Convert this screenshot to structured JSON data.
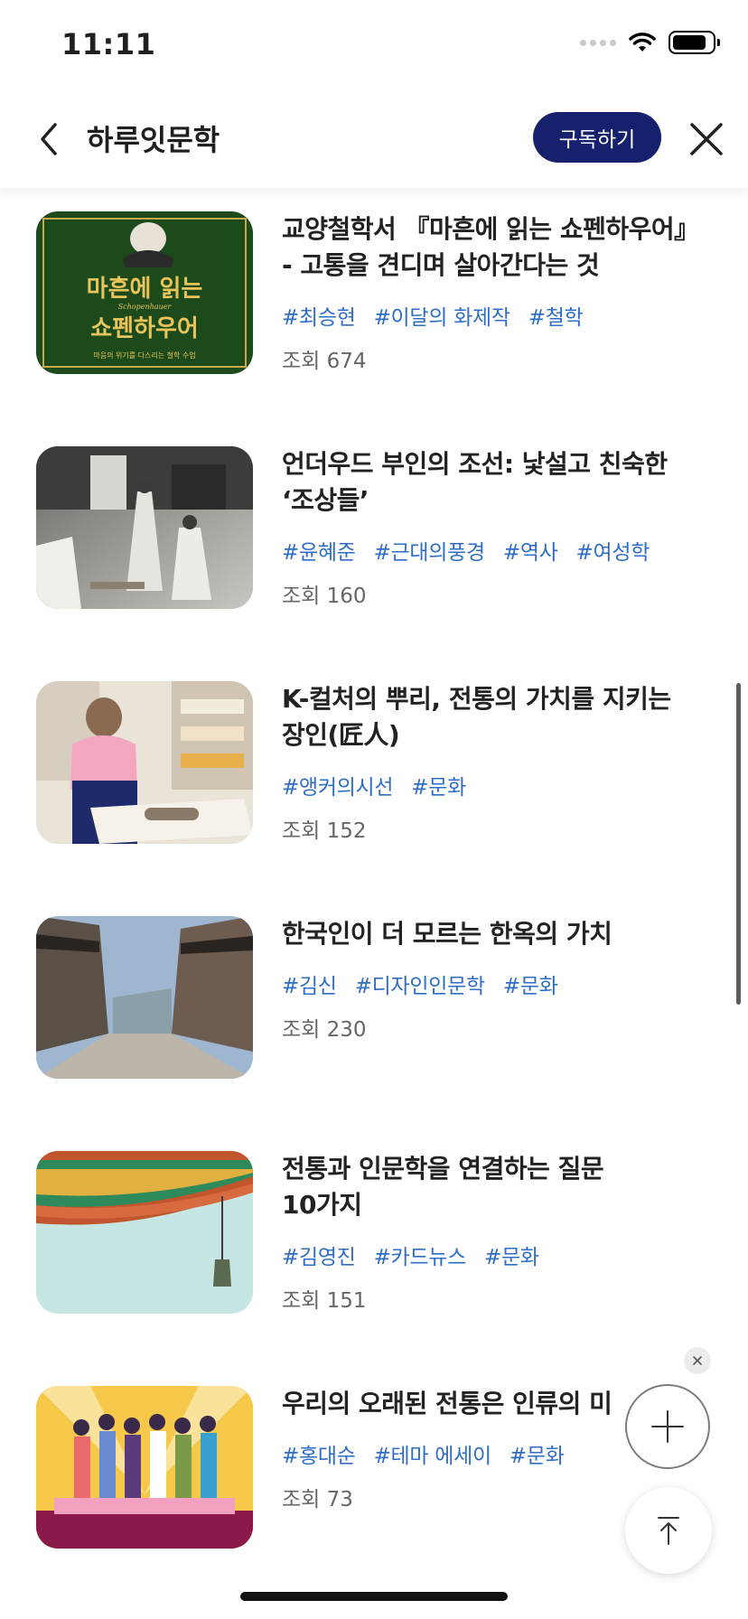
{
  "status_bar": {
    "time": "11:11"
  },
  "header": {
    "title": "하루잇문학",
    "subscribe_label": "구독하기"
  },
  "articles": [
    {
      "title": "교양철학서 『마흔에 읽는 쇼펜하우어』\n- 고통을 견디며 살아간다는 것",
      "tags": [
        "#최승현",
        "#이달의 화제작",
        "#철학"
      ],
      "views": "조회 674",
      "thumb": {
        "line1": "마흔에 읽는",
        "line2": "쇼펜하우어",
        "sub": "Schopenhauer",
        "caption": "마음의 위기를 다스리는 철학 수업"
      }
    },
    {
      "title": "언더우드 부인의 조선: 낯설고 친숙한\n‘조상들’",
      "tags": [
        "#윤혜준",
        "#근대의풍경",
        "#역사",
        "#여성학"
      ],
      "views": "조회 160"
    },
    {
      "title": "K-컬처의 뿌리, 전통의 가치를 지키는\n장인(匠人)",
      "tags": [
        "#앵커의시선",
        "#문화"
      ],
      "views": "조회 152"
    },
    {
      "title": "한국인이 더 모르는 한옥의 가치",
      "tags": [
        "#김신",
        "#디자인인문학",
        "#문화"
      ],
      "views": "조회 230"
    },
    {
      "title": "전통과 인문학을 연결하는 질문\n10가지",
      "tags": [
        "#김영진",
        "#카드뉴스",
        "#문화"
      ],
      "views": "조회 151"
    },
    {
      "title": "우리의 오래된 전통은 인류의 미",
      "tags": [
        "#홍대순",
        "#테마 에세이",
        "#문화"
      ],
      "views": "조회 73"
    }
  ],
  "colors": {
    "accent": "#16216e",
    "tag": "#2f6dc7",
    "text": "#222222",
    "muted": "#666666"
  },
  "icons": [
    "back-icon",
    "close-icon",
    "plus-icon",
    "scroll-top-icon",
    "wifi-icon",
    "battery-icon"
  ]
}
